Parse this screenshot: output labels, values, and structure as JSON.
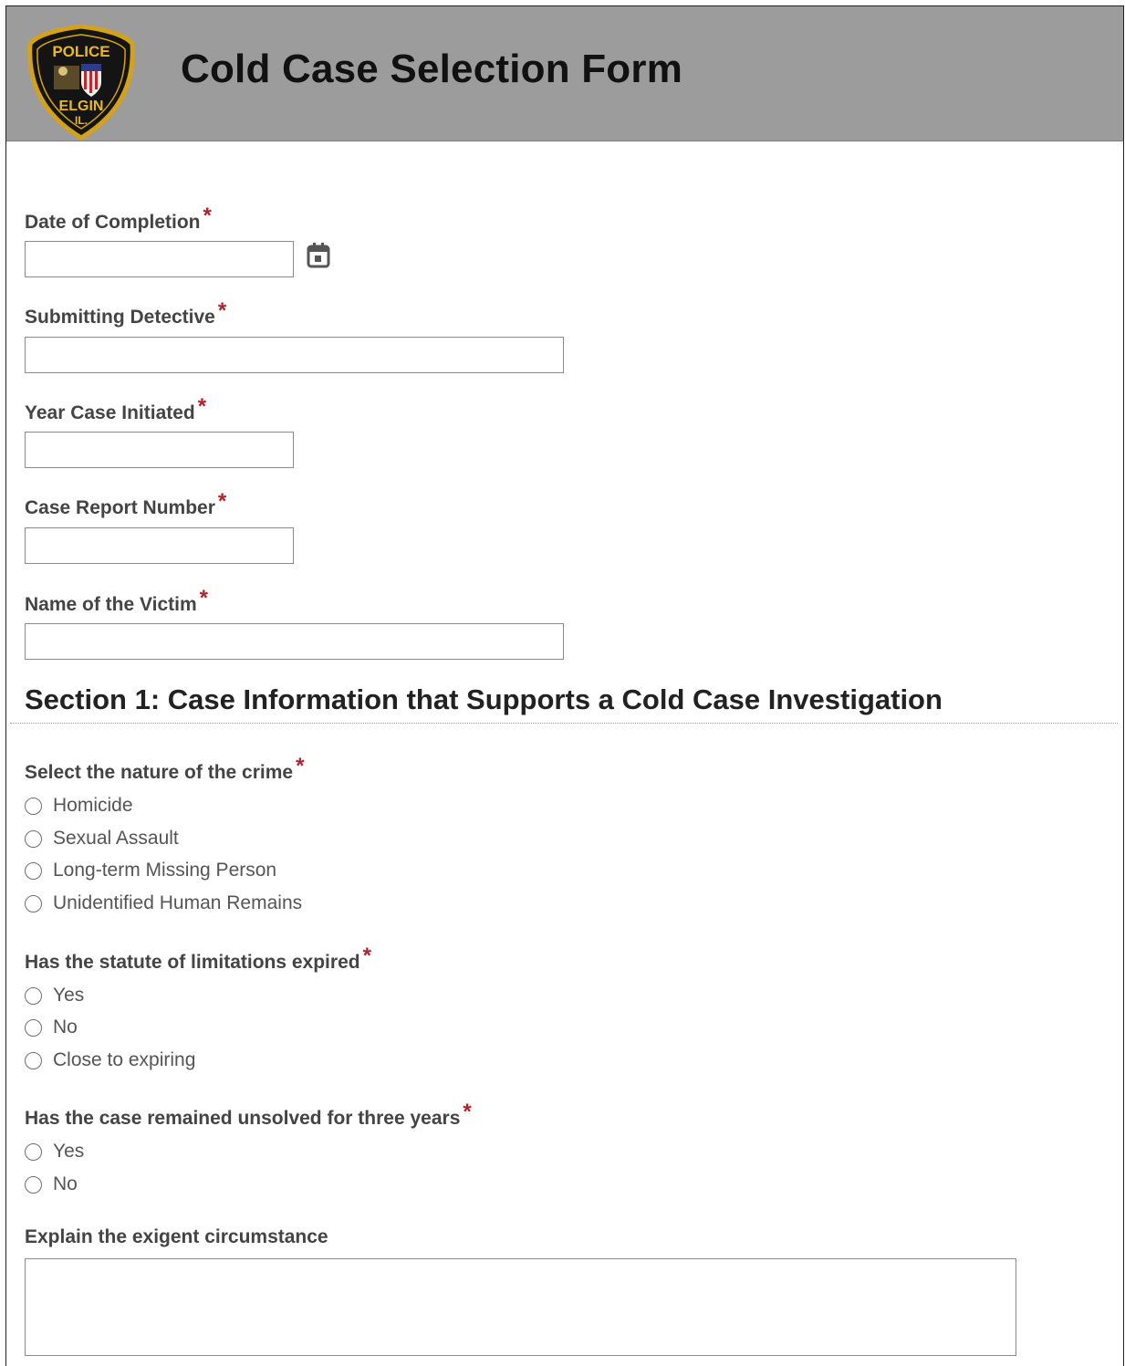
{
  "header": {
    "title": "Cold Case Selection Form",
    "logo": {
      "top_text": "POLICE",
      "bottom_text": "ELGIN",
      "state_text": "IL.",
      "icon": "police-badge-logo"
    }
  },
  "fields": {
    "date_of_completion": {
      "label": "Date of Completion",
      "required_mark": "*",
      "value": "",
      "calendar_icon": "calendar-icon"
    },
    "submitting_detective": {
      "label": "Submitting Detective",
      "required_mark": "*",
      "value": ""
    },
    "year_case_initiated": {
      "label": "Year Case Initiated",
      "required_mark": "*",
      "value": ""
    },
    "case_report_number": {
      "label": "Case Report Number",
      "required_mark": "*",
      "value": ""
    },
    "name_of_victim": {
      "label": "Name of the Victim",
      "required_mark": "*",
      "value": ""
    }
  },
  "section1": {
    "title": "Section 1: Case Information that Supports a Cold Case Investigation",
    "nature_of_crime": {
      "label": "Select the nature of the crime",
      "required_mark": "*",
      "options": [
        "Homicide",
        "Sexual Assault",
        "Long-term Missing Person",
        "Unidentified Human Remains"
      ]
    },
    "statute_expired": {
      "label": "Has the statute of limitations expired",
      "required_mark": "*",
      "options": [
        "Yes",
        "No",
        "Close to expiring"
      ]
    },
    "unsolved_three_years": {
      "label": "Has the case remained unsolved for three years",
      "required_mark": "*",
      "options": [
        "Yes",
        "No"
      ]
    },
    "exigent_circumstance": {
      "label": "Explain the exigent circumstance",
      "value": ""
    }
  },
  "colors": {
    "header_bg": "#9c9c9c",
    "required_red": "#b0232a",
    "badge_gold": "#d4a21a",
    "badge_black": "#141414"
  }
}
